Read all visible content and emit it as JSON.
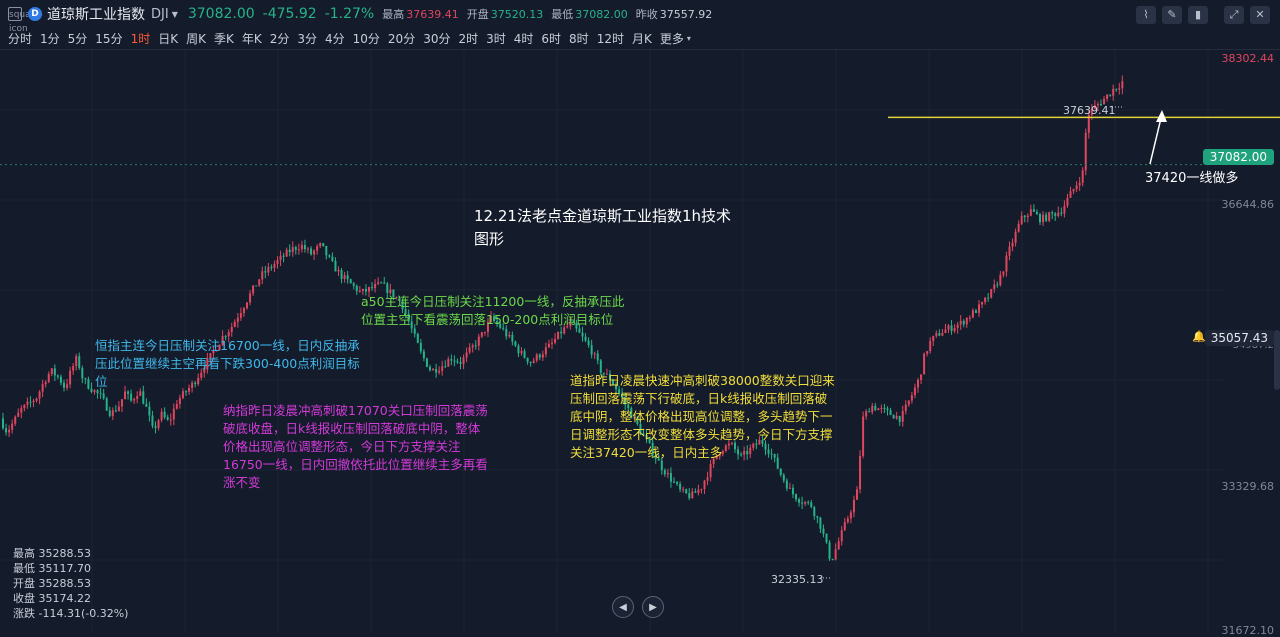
{
  "header": {
    "icon": "square-icon",
    "logo": "D",
    "name": "道琼斯工业指数",
    "code": "DJI",
    "price": "37082.00",
    "change": "-475.92",
    "change_pct": "-1.27%",
    "high_label": "最高",
    "high": "37639.41",
    "open_label": "开盘",
    "open": "37520.13",
    "low_label": "最低",
    "low": "37082.00",
    "prev_label": "昨收",
    "prev": "37557.92"
  },
  "timeframes": [
    "分时",
    "1分",
    "5分",
    "15分",
    "1时",
    "日K",
    "周K",
    "季K",
    "年K",
    "2分",
    "3分",
    "4分",
    "10分",
    "20分",
    "30分",
    "2时",
    "3时",
    "4时",
    "6时",
    "8时",
    "12时",
    "月K",
    "更多"
  ],
  "active_timeframe": "1时",
  "more_caret": "▾",
  "toolbar": {
    "indicator": "⌇",
    "draw": "✎",
    "candle": "▮",
    "expand": "⤢",
    "close": "✕"
  },
  "price_axis": {
    "labels": [
      {
        "text": "38302.44",
        "color": "#e0465e"
      },
      {
        "text": "36644.86",
        "color": "#7f8899"
      },
      {
        "text": "33329.68",
        "color": "#7f8899"
      },
      {
        "text": "31672.10",
        "color": "#7f8899"
      },
      {
        "text": "34987.2",
        "color": "#7f8899"
      }
    ],
    "current_price": "37082.00",
    "alert_price": "35057.43",
    "bell_icon": "🔔"
  },
  "highlights": {
    "high": "37639.41",
    "low": "32335.13"
  },
  "annotations": {
    "title": [
      "12.21法老点金道琼斯工业指数1h技术",
      "图形"
    ],
    "hsi": [
      "恒指主连今日压制关注16700一线，日内反抽承",
      "压此位置继续主空再看下跌300-400点利润目标",
      "位"
    ],
    "a50": [
      "a50主连今日压制关注11200一线，反抽承压此",
      "位置主空下看震荡回落150-200点利润目标位"
    ],
    "nasdaq": [
      "纳指昨日凌晨冲高刺破17070关口压制回落震荡",
      "破底收盘，日k线报收压制回落破底中阴，整体",
      "价格出现高位调整形态，今日下方支撑关注",
      "16750一线，日内回撤依托此位置继续主多再看",
      "涨不变"
    ],
    "dow": [
      "道指昨日凌晨快速冲高刺破38000整数关口迎来",
      "压制回落震荡下行破底，日k线报收压制回落破",
      "底中阴，整体价格出现高位调整，多头趋势下一",
      "日调整形态不改变整体多头趋势，今日下方支撑",
      "关注37420一线，日内主多"
    ],
    "support": "37420一线做多"
  },
  "stats": {
    "high": "最高 35288.53",
    "low": "最低 35117.70",
    "open": "开盘 35288.53",
    "close": "收盘 35174.22",
    "change": "涨跌 -114.31(-0.32%)"
  },
  "nav": {
    "prev": "◀",
    "next": "▶"
  },
  "colors": {
    "up": "#e0465e",
    "down": "#26b38a",
    "support_line": "#e3d23a",
    "background": "#141b2b"
  },
  "chart_data": {
    "type": "candlestick",
    "ylim": [
      31672.1,
      38302.44
    ],
    "support_level": 37420,
    "current_price": 37082.0,
    "path": [
      [
        0,
        34150
      ],
      [
        3,
        34050
      ],
      [
        6,
        34000
      ],
      [
        12,
        34100
      ],
      [
        20,
        34250
      ],
      [
        28,
        34320
      ],
      [
        36,
        34400
      ],
      [
        44,
        34600
      ],
      [
        50,
        34700
      ],
      [
        58,
        34620
      ],
      [
        64,
        34500
      ],
      [
        70,
        34700
      ],
      [
        76,
        34850
      ],
      [
        82,
        34600
      ],
      [
        90,
        34500
      ],
      [
        100,
        34400
      ],
      [
        110,
        34200
      ],
      [
        118,
        34300
      ],
      [
        124,
        34450
      ],
      [
        130,
        34350
      ],
      [
        138,
        34480
      ],
      [
        146,
        34250
      ],
      [
        152,
        34000
      ],
      [
        160,
        34200
      ],
      [
        168,
        34100
      ],
      [
        176,
        34350
      ],
      [
        184,
        34450
      ],
      [
        192,
        34550
      ],
      [
        200,
        34700
      ],
      [
        206,
        34800
      ],
      [
        214,
        34950
      ],
      [
        222,
        35100
      ],
      [
        230,
        35200
      ],
      [
        240,
        35400
      ],
      [
        250,
        35600
      ],
      [
        260,
        35800
      ],
      [
        270,
        35900
      ],
      [
        280,
        36000
      ],
      [
        290,
        36100
      ],
      [
        300,
        36150
      ],
      [
        310,
        36050
      ],
      [
        320,
        36150
      ],
      [
        330,
        35950
      ],
      [
        340,
        35800
      ],
      [
        350,
        35700
      ],
      [
        360,
        35600
      ],
      [
        370,
        35650
      ],
      [
        380,
        35700
      ],
      [
        390,
        35600
      ],
      [
        400,
        35500
      ],
      [
        410,
        35200
      ],
      [
        420,
        34900
      ],
      [
        430,
        34700
      ],
      [
        440,
        34750
      ],
      [
        450,
        34850
      ],
      [
        460,
        34800
      ],
      [
        470,
        34950
      ],
      [
        480,
        35100
      ],
      [
        490,
        35300
      ],
      [
        500,
        35200
      ],
      [
        510,
        35050
      ],
      [
        520,
        34900
      ],
      [
        530,
        34800
      ],
      [
        540,
        34900
      ],
      [
        550,
        35000
      ],
      [
        560,
        35150
      ],
      [
        570,
        35250
      ],
      [
        580,
        35100
      ],
      [
        590,
        34950
      ],
      [
        600,
        34700
      ],
      [
        610,
        34600
      ],
      [
        620,
        34400
      ],
      [
        630,
        34200
      ],
      [
        640,
        34000
      ],
      [
        650,
        33800
      ],
      [
        660,
        33600
      ],
      [
        670,
        33450
      ],
      [
        680,
        33300
      ],
      [
        690,
        33250
      ],
      [
        700,
        33350
      ],
      [
        710,
        33600
      ],
      [
        720,
        33800
      ],
      [
        730,
        33850
      ],
      [
        740,
        33700
      ],
      [
        750,
        33800
      ],
      [
        760,
        33900
      ],
      [
        770,
        33750
      ],
      [
        780,
        33500
      ],
      [
        790,
        33300
      ],
      [
        800,
        33200
      ],
      [
        810,
        33150
      ],
      [
        820,
        32900
      ],
      [
        830,
        32500
      ],
      [
        840,
        32800
      ],
      [
        850,
        33100
      ],
      [
        856,
        33300
      ],
      [
        862,
        34150
      ],
      [
        870,
        34300
      ],
      [
        880,
        34250
      ],
      [
        890,
        34200
      ],
      [
        900,
        34150
      ],
      [
        906,
        34300
      ],
      [
        912,
        34450
      ],
      [
        918,
        34600
      ],
      [
        924,
        34900
      ],
      [
        930,
        35050
      ],
      [
        940,
        35150
      ],
      [
        950,
        35200
      ],
      [
        960,
        35250
      ],
      [
        970,
        35350
      ],
      [
        980,
        35450
      ],
      [
        990,
        35600
      ],
      [
        1000,
        35800
      ],
      [
        1010,
        36150
      ],
      [
        1020,
        36450
      ],
      [
        1030,
        36550
      ],
      [
        1040,
        36450
      ],
      [
        1050,
        36500
      ],
      [
        1060,
        36550
      ],
      [
        1070,
        36750
      ],
      [
        1078,
        36900
      ],
      [
        1082,
        37000
      ],
      [
        1086,
        37650
      ],
      [
        1094,
        37750
      ],
      [
        1104,
        37850
      ],
      [
        1112,
        37950
      ],
      [
        1118,
        38000
      ],
      [
        1122,
        38050
      ],
      [
        1125,
        37100
      ]
    ]
  }
}
